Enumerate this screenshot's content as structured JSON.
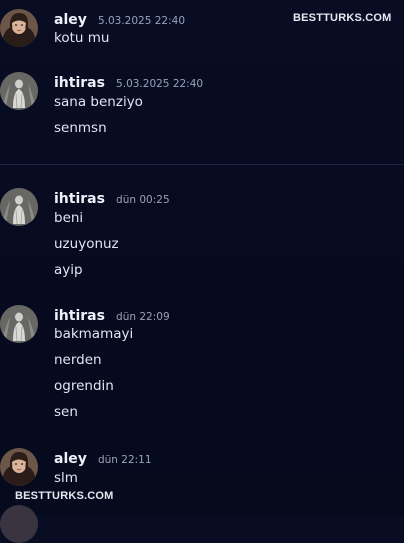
{
  "watermark": {
    "top": "BESTTURKS.COM",
    "bottom": "BESTTURKS.COM"
  },
  "groups": [
    {
      "user": "aley",
      "time": "5.03.2025 22:40",
      "avatar": "woman-portrait-avatar",
      "lines": [
        "kotu mu"
      ]
    },
    {
      "user": "ihtiras",
      "time": "5.03.2025 22:40",
      "avatar": "statue-avatar",
      "lines": [
        "sana benziyo",
        "senmsn"
      ]
    },
    {
      "user": "ihtiras",
      "time": "dün 00:25",
      "avatar": "statue-avatar",
      "lines": [
        "beni",
        "uzuyonuz",
        "ayip"
      ]
    },
    {
      "user": "ihtiras",
      "time": "dün 22:09",
      "avatar": "statue-avatar",
      "lines": [
        "bakmamayi",
        "nerden",
        "ogrendin",
        "sen"
      ]
    },
    {
      "user": "aley",
      "time": "dün 22:11",
      "avatar": "woman-portrait-avatar",
      "lines": [
        "slm"
      ]
    }
  ]
}
